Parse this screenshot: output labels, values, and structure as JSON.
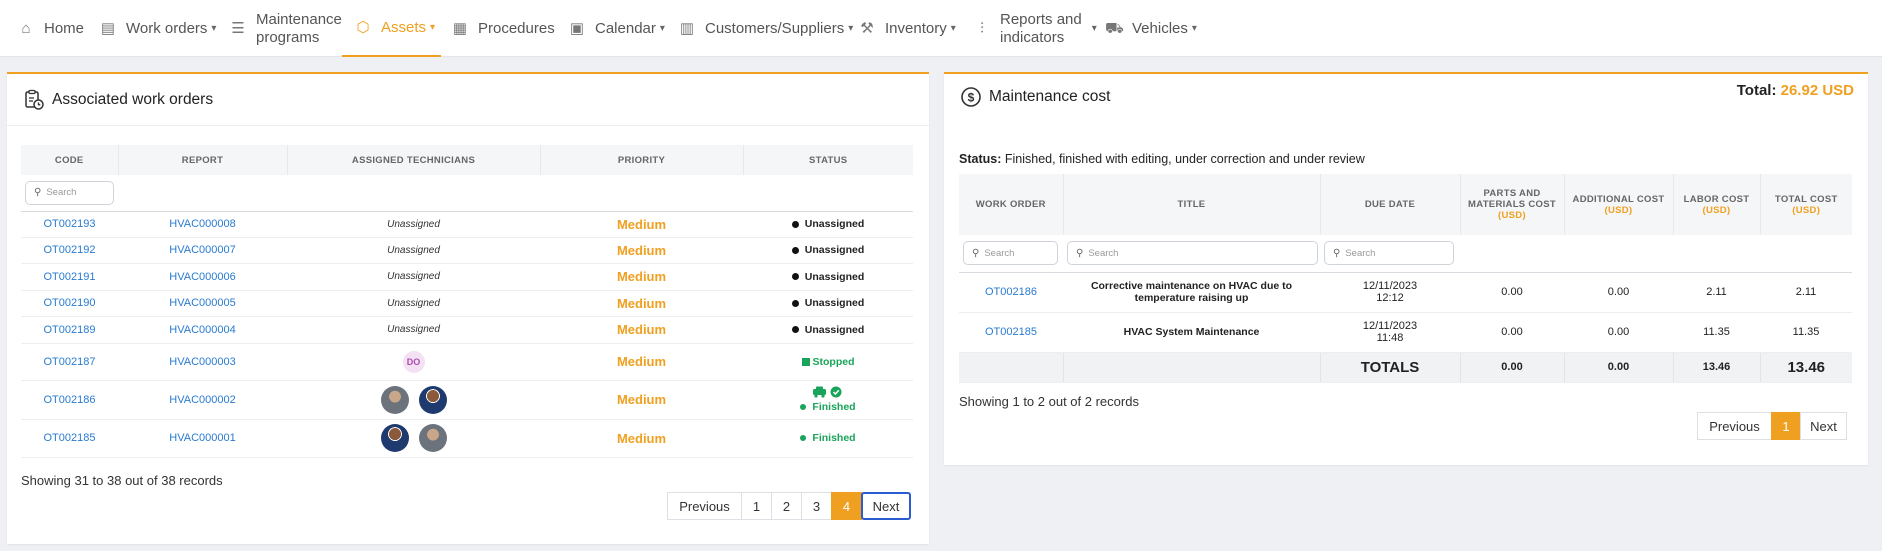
{
  "nav": {
    "items": [
      {
        "label": "Home",
        "icon": "home-icon"
      },
      {
        "label": "Work orders",
        "icon": "clipboard-icon"
      },
      {
        "label1": "Maintenance",
        "label2": "programs",
        "icon": "list-icon"
      },
      {
        "label": "Assets",
        "icon": "cube-icon"
      },
      {
        "label": "Procedures",
        "icon": "clipboard-list-icon"
      },
      {
        "label": "Calendar",
        "icon": "calendar-icon"
      },
      {
        "label": "Customers/Suppliers",
        "icon": "building-icon"
      },
      {
        "label": "Inventory",
        "icon": "tools-icon"
      },
      {
        "label1": "Reports and",
        "label2": "indicators",
        "icon": "chart-icon"
      },
      {
        "label": "Vehicles",
        "icon": "truck-icon"
      }
    ],
    "active": "Assets"
  },
  "left": {
    "title": "Associated work orders",
    "columns": [
      "CODE",
      "REPORT",
      "ASSIGNED TECHNICIANS",
      "PRIORITY",
      "STATUS"
    ],
    "search_placeholder": "Search",
    "rows": [
      {
        "code": "OT002193",
        "report": "HVAC000008",
        "tech": "Unassigned",
        "priority": "Medium",
        "status": "Unassigned"
      },
      {
        "code": "OT002192",
        "report": "HVAC000007",
        "tech": "Unassigned",
        "priority": "Medium",
        "status": "Unassigned"
      },
      {
        "code": "OT002191",
        "report": "HVAC000006",
        "tech": "Unassigned",
        "priority": "Medium",
        "status": "Unassigned"
      },
      {
        "code": "OT002190",
        "report": "HVAC000005",
        "tech": "Unassigned",
        "priority": "Medium",
        "status": "Unassigned"
      },
      {
        "code": "OT002189",
        "report": "HVAC000004",
        "tech": "Unassigned",
        "priority": "Medium",
        "status": "Unassigned"
      },
      {
        "code": "OT002187",
        "report": "HVAC000003",
        "tech_initials": "DO",
        "priority": "Medium",
        "status": "Stopped"
      },
      {
        "code": "OT002186",
        "report": "HVAC000002",
        "priority": "Medium",
        "status": "Finished"
      },
      {
        "code": "OT002185",
        "report": "HVAC000001",
        "priority": "Medium",
        "status": "Finished"
      }
    ],
    "records": "Showing 31 to 38 out of 38 records",
    "pager": {
      "prev": "Previous",
      "pages": [
        "1",
        "2",
        "3",
        "4"
      ],
      "active": "4",
      "next": "Next"
    }
  },
  "right": {
    "title": "Maintenance cost",
    "total_label": "Total:",
    "total_value": "26.92 USD",
    "status_label": "Status:",
    "status_text": "Finished, finished with editing, under correction and under review",
    "columns": {
      "work_order": "WORK ORDER",
      "title": "TITLE",
      "due_date": "DUE DATE",
      "parts1": "PARTS AND",
      "parts2": "MATERIALS COST",
      "additional": "ADDITIONAL COST",
      "labor": "LABOR COST",
      "total": "TOTAL COST",
      "usd": "(USD)"
    },
    "search_placeholder": "Search",
    "rows": [
      {
        "wo": "OT002186",
        "title1": "Corrective maintenance on HVAC due to",
        "title2": "temperature raising up",
        "date": "12/11/2023",
        "time": "12:12",
        "parts": "0.00",
        "additional": "0.00",
        "labor": "2.11",
        "total": "2.11"
      },
      {
        "wo": "OT002185",
        "title1": "HVAC System Maintenance",
        "title2": "",
        "date": "12/11/2023",
        "time": "11:48",
        "parts": "0.00",
        "additional": "0.00",
        "labor": "11.35",
        "total": "11.35"
      }
    ],
    "totals": {
      "label": "TOTALS",
      "parts": "0.00",
      "additional": "0.00",
      "labor": "13.46",
      "total": "13.46"
    },
    "records": "Showing 1 to 2 out of 2 records",
    "pager": {
      "prev": "Previous",
      "page": "1",
      "next": "Next"
    }
  },
  "colors": {
    "accent": "#f0a020",
    "link": "#2a7bd0",
    "success": "#1aa35a"
  }
}
